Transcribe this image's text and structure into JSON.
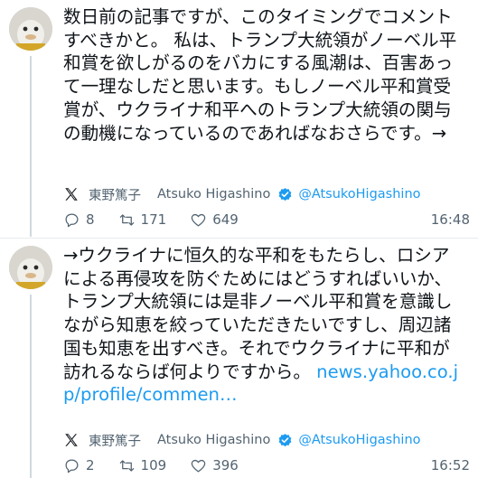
{
  "posts": [
    {
      "text": "数日前の記事ですが、このタイミングでコメントすべきかと。 私は、トランプ大統領がノーベル平和賞を欲しがるのをバカにする風潮は、百害あって一理なしだと思います。もしノーベル平和賞受賞が、ウクライナ和平へのトランプ大統領の関与の動機になっているのであればなおさらです。→",
      "link": "",
      "author_jp": "東野篤子",
      "author_en": "Atsuko Higashino",
      "handle": "@AtsukoHigashino",
      "replies": "8",
      "reposts": "171",
      "likes": "649",
      "time": "16:48"
    },
    {
      "text": "→ウクライナに恒久的な平和をもたらし、ロシアによる再侵攻を防ぐためにはどうすればいいか、トランプ大統領には是非ノーベル平和賞を意識しながら知恵を絞っていただきたいですし、周辺諸国も知恵を出すべき。それでウクライナに平和が訪れるならば何よりですから。 ",
      "link": "news.yahoo.co.jp/profile/commen…",
      "author_jp": "東野篤子",
      "author_en": "Atsuko Higashino",
      "handle": "@AtsukoHigashino",
      "replies": "2",
      "reposts": "109",
      "likes": "396",
      "time": "16:52"
    }
  ],
  "icons": {
    "avatar": "avatar-icon",
    "source": "x-logo-icon",
    "verified": "verified-badge-icon",
    "reply": "reply-icon",
    "repost": "repost-icon",
    "like": "like-icon"
  },
  "colors": {
    "accent": "#1d9bf0",
    "muted": "#536471",
    "text": "#0f1419"
  }
}
